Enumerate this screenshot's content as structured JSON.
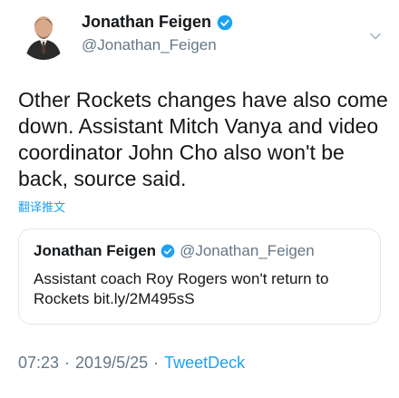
{
  "author": {
    "name": "Jonathan Feigen",
    "handle": "@Jonathan_Feigen",
    "avatar_icon": "person-avatar-icon",
    "verified_icon": "verified-badge-icon"
  },
  "tweet": {
    "text": "Other Rockets changes have also come down. Assistant Mitch Vanya and video coordinator John Cho also won't be back, source said.",
    "translate_label": "翻译推文"
  },
  "quoted": {
    "name": "Jonathan Feigen",
    "handle": "@Jonathan_Feigen",
    "text": "Assistant coach Roy Rogers won't return to Rockets bit.ly/2M495sS"
  },
  "meta": {
    "time": "07:23",
    "separator": "·",
    "date": "2019/5/25",
    "source": "TweetDeck"
  },
  "colors": {
    "accent": "#1da1f2",
    "secondary_text": "#657786",
    "border": "#e1e8ed"
  }
}
